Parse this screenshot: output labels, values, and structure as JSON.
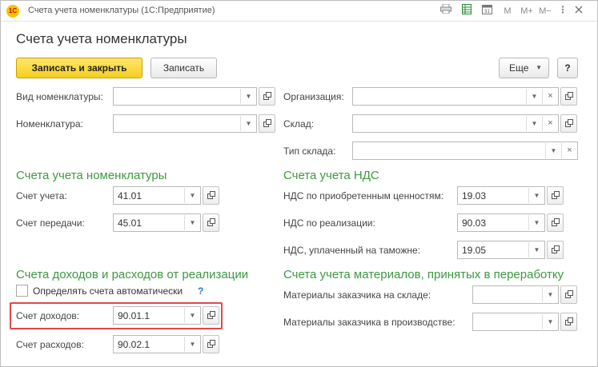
{
  "window": {
    "title": "Счета учета номенклатуры  (1С:Предприятие)",
    "logo_text": "1С",
    "tools": {
      "m": "M",
      "mplus": "M+",
      "mminus": "M−"
    }
  },
  "page": {
    "title": "Счета учета номенклатуры"
  },
  "toolbar": {
    "save_close": "Записать и закрыть",
    "save": "Записать",
    "more": "Еще",
    "help": "?"
  },
  "filters": {
    "item_type_label": "Вид номенклатуры:",
    "item_label": "Номенклатура:",
    "org_label": "Организация:",
    "warehouse_label": "Склад:",
    "warehouse_type_label": "Тип склада:"
  },
  "sections": {
    "accounting": {
      "title": "Счета учета номенклатуры",
      "account_label": "Счет учета:",
      "account_value": "41.01",
      "transfer_label": "Счет передачи:",
      "transfer_value": "45.01"
    },
    "vat": {
      "title": "Счета учета НДС",
      "acquired_label": "НДС по приобретенным ценностям:",
      "acquired_value": "19.03",
      "sales_label": "НДС по реализации:",
      "sales_value": "90.03",
      "customs_label": "НДС, уплаченный на таможне:",
      "customs_value": "19.05"
    },
    "income": {
      "title": "Счета доходов и расходов от реализации",
      "auto_label": "Определять счета автоматически",
      "auto_help": "?",
      "auto_checked": false,
      "income_label": "Счет доходов:",
      "income_value": "90.01.1",
      "expense_label": "Счет расходов:",
      "expense_value": "90.02.1"
    },
    "materials": {
      "title": "Счета учета материалов, принятых в переработку",
      "warehouse_label": "Материалы заказчика на складе:",
      "production_label": "Материалы заказчика в производстве:"
    }
  },
  "colors": {
    "accent_green": "#3d9940",
    "primary_button": "#f7cf20",
    "highlight": "#e24848",
    "help_link": "#2a7ad5"
  }
}
